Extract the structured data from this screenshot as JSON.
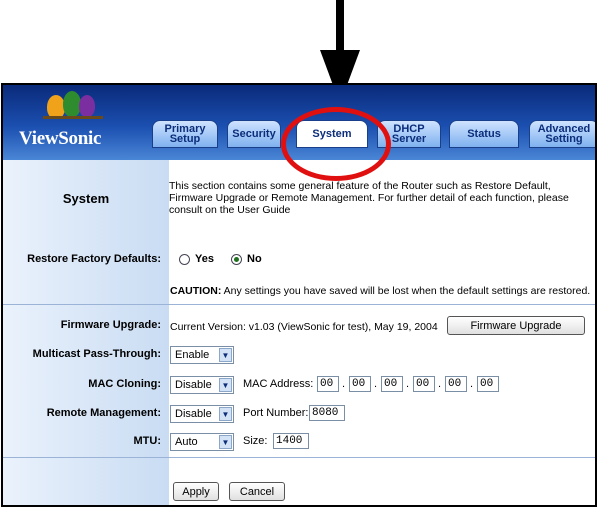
{
  "brand": {
    "logo_text": "ViewSonic"
  },
  "tabs": [
    {
      "label": "Primary Setup",
      "active": false
    },
    {
      "label": "Security",
      "active": false
    },
    {
      "label": "System",
      "active": true
    },
    {
      "label": "DHCP Server",
      "active": false
    },
    {
      "label": "Status",
      "active": false
    },
    {
      "label": "Advanced Setting",
      "active": false
    }
  ],
  "section": {
    "title": "System",
    "description": "This section contains some general feature of the Router such as Restore Default, Firmware Upgrade or Remote Management. For further detail of each function, please consult on the User Guide"
  },
  "restore": {
    "label": "Restore Factory Defaults:",
    "yes_label": "Yes",
    "no_label": "No",
    "selected": "No",
    "caution_bold": "CAUTION:",
    "caution_text": " Any settings you have saved will be lost when the default settings are restored."
  },
  "firmware": {
    "label": "Firmware Upgrade:",
    "current_version": "Current Version: v1.03 (ViewSonic for test), May 19, 2004",
    "button_label": "Firmware Upgrade"
  },
  "multicast": {
    "label": "Multicast Pass-Through:",
    "value": "Enable"
  },
  "mac_cloning": {
    "label": "MAC Cloning:",
    "value": "Disable",
    "address_label": "MAC Address:",
    "octets": [
      "00",
      "00",
      "00",
      "00",
      "00",
      "00"
    ],
    "separator": "."
  },
  "remote_mgmt": {
    "label": "Remote Management:",
    "value": "Disable",
    "port_label": "Port Number:",
    "port": "8080"
  },
  "mtu": {
    "label": "MTU:",
    "value": "Auto",
    "size_label": "Size:",
    "size": "1400"
  },
  "actions": {
    "apply_label": "Apply",
    "cancel_label": "Cancel"
  },
  "colors": {
    "header": "#1b4fb0",
    "tab_text": "#0b2d7a",
    "highlight": "#e01010"
  }
}
